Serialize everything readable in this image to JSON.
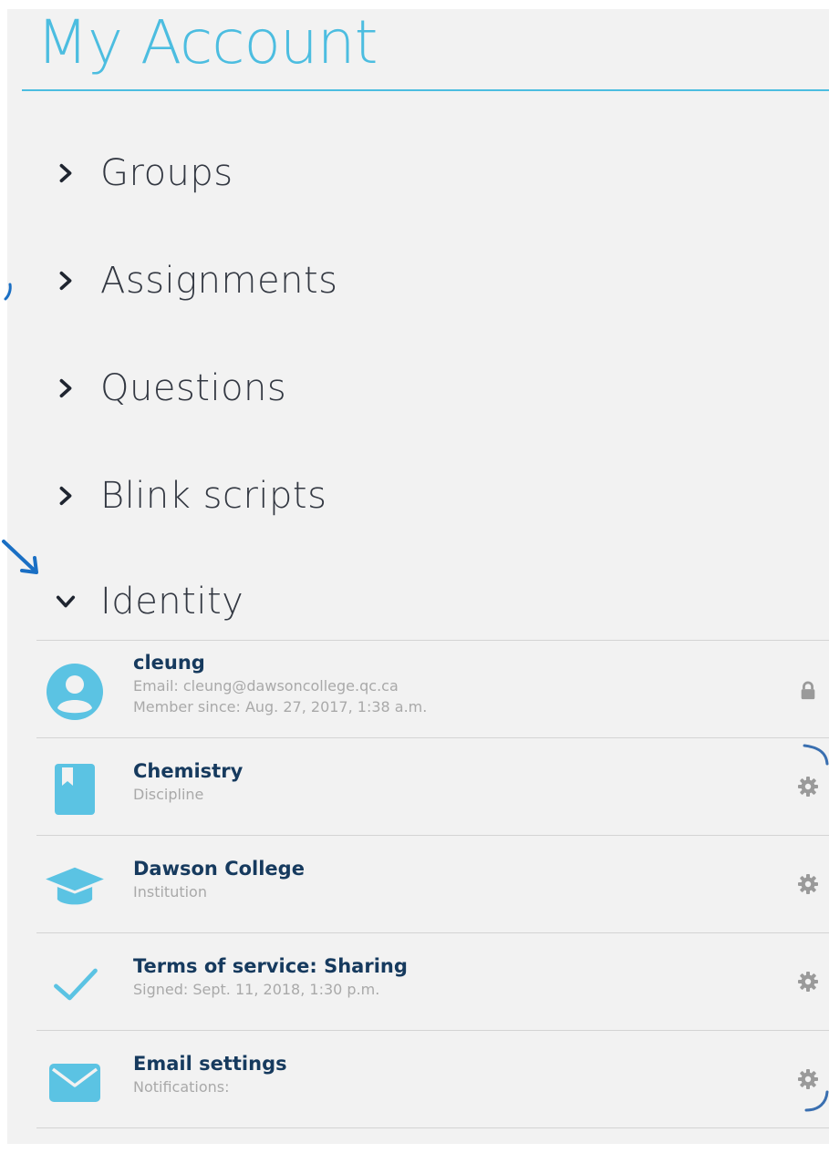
{
  "page": {
    "title": "My Account"
  },
  "nav": {
    "items": [
      {
        "label": "Groups",
        "expanded": false
      },
      {
        "label": "Assignments",
        "expanded": false
      },
      {
        "label": "Questions",
        "expanded": false
      },
      {
        "label": "Blink scripts",
        "expanded": false
      },
      {
        "label": "Identity",
        "expanded": true
      }
    ]
  },
  "identity": {
    "rows": [
      {
        "icon": "user-avatar-icon",
        "name": "cleung",
        "lines": [
          "Email: cleung@dawsoncollege.qc.ca",
          "Member since: Aug. 27, 2017, 1:38 a.m."
        ],
        "action_icon": "lock-icon"
      },
      {
        "icon": "book-icon",
        "name": "Chemistry",
        "lines": [
          "Discipline"
        ],
        "action_icon": "gear-icon"
      },
      {
        "icon": "graduation-cap-icon",
        "name": "Dawson College",
        "lines": [
          "Institution"
        ],
        "action_icon": "gear-icon"
      },
      {
        "icon": "checkmark-icon",
        "name": "Terms of service: Sharing",
        "lines": [
          "Signed: Sept. 11, 2018, 1:30 p.m."
        ],
        "action_icon": "gear-icon"
      },
      {
        "icon": "envelope-icon",
        "name": "Email settings",
        "lines": [
          "Notifications:"
        ],
        "action_icon": "gear-icon"
      }
    ]
  },
  "colors": {
    "accent": "#4cbde0",
    "icon_blue": "#5bc3e3",
    "name_text": "#163a5e",
    "sub_text": "#a9a9a9",
    "nav_text": "#333842",
    "panel_bg": "#f2f2f2",
    "annotation": "#1a6fc4"
  }
}
